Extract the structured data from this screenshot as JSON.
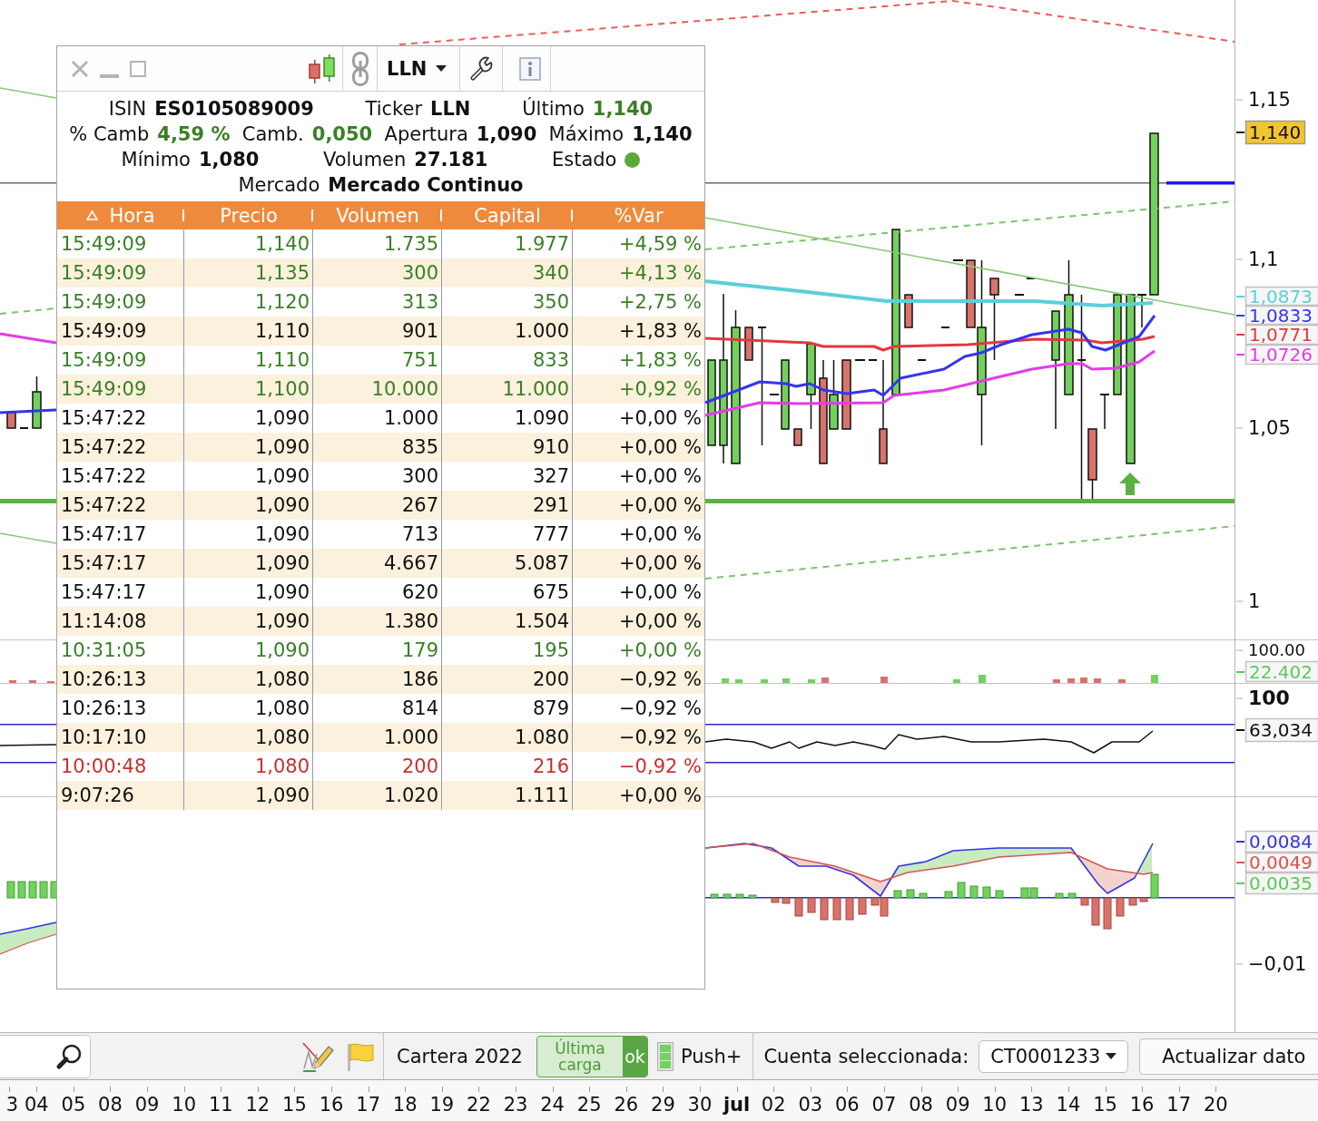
{
  "quote_window": {
    "symbol": "LLN",
    "quote_lines": [
      [
        {
          "kind": "value",
          "label": "ISIN",
          "value": "ES0105089009",
          "color": "#111111",
          "bold": true
        },
        {
          "kind": "value",
          "label": "Ticker",
          "value": "LLN",
          "color": "#111111",
          "bold": true
        },
        {
          "kind": "value",
          "label": "Último",
          "value": "1,140",
          "color": "#3b7f26",
          "bold": true
        }
      ],
      [
        {
          "kind": "value",
          "label": "% Camb",
          "value": "4,59 %",
          "color": "#3b7f26",
          "bold": true
        },
        {
          "kind": "value",
          "label": "Camb.",
          "value": "0,050",
          "color": "#3b7f26",
          "bold": true
        },
        {
          "kind": "value",
          "label": "Apertura",
          "value": "1,090",
          "color": "#111111",
          "bold": true
        },
        {
          "kind": "value",
          "label": "Máximo",
          "value": "1,140",
          "color": "#111111",
          "bold": true
        }
      ],
      [
        {
          "kind": "value",
          "label": "Mínimo",
          "value": "1,080",
          "color": "#111111",
          "bold": true
        },
        {
          "kind": "value",
          "label": "Volumen",
          "value": "27.181",
          "color": "#111111",
          "bold": true
        },
        {
          "kind": "status",
          "label": "Estado",
          "color": "#5aaa38"
        }
      ],
      [
        {
          "kind": "value",
          "label": "Mercado",
          "value": "Mercado Continuo",
          "color": "#111111",
          "bold": true
        }
      ]
    ],
    "table": {
      "columns": [
        {
          "label": "Hora",
          "sorted": true
        },
        {
          "label": "Precio",
          "sorted": false
        },
        {
          "label": "Volumen",
          "sorted": false
        },
        {
          "label": "Capital",
          "sorted": false
        },
        {
          "label": "%Var",
          "sorted": false
        }
      ],
      "rows": [
        {
          "color": "#3b7f26",
          "cells": [
            "15:49:09",
            "1,140",
            "1.735",
            "1.977",
            "+4,59 %"
          ]
        },
        {
          "color": "#3b7f26",
          "cells": [
            "15:49:09",
            "1,135",
            "300",
            "340",
            "+4,13 %"
          ]
        },
        {
          "color": "#3b7f26",
          "cells": [
            "15:49:09",
            "1,120",
            "313",
            "350",
            "+2,75 %"
          ]
        },
        {
          "color": "#111111",
          "cells": [
            "15:49:09",
            "1,110",
            "901",
            "1.000",
            "+1,83 %"
          ]
        },
        {
          "color": "#3b7f26",
          "cells": [
            "15:49:09",
            "1,110",
            "751",
            "833",
            "+1,83 %"
          ]
        },
        {
          "color": "#3b7f26",
          "cells": [
            "15:49:09",
            "1,100",
            "10.000",
            "11.000",
            "+0,92 %"
          ]
        },
        {
          "color": "#111111",
          "cells": [
            "15:47:22",
            "1,090",
            "1.000",
            "1.090",
            "+0,00 %"
          ]
        },
        {
          "color": "#111111",
          "cells": [
            "15:47:22",
            "1,090",
            "835",
            "910",
            "+0,00 %"
          ]
        },
        {
          "color": "#111111",
          "cells": [
            "15:47:22",
            "1,090",
            "300",
            "327",
            "+0,00 %"
          ]
        },
        {
          "color": "#111111",
          "cells": [
            "15:47:22",
            "1,090",
            "267",
            "291",
            "+0,00 %"
          ]
        },
        {
          "color": "#111111",
          "cells": [
            "15:47:17",
            "1,090",
            "713",
            "777",
            "+0,00 %"
          ]
        },
        {
          "color": "#111111",
          "cells": [
            "15:47:17",
            "1,090",
            "4.667",
            "5.087",
            "+0,00 %"
          ]
        },
        {
          "color": "#111111",
          "cells": [
            "15:47:17",
            "1,090",
            "620",
            "675",
            "+0,00 %"
          ]
        },
        {
          "color": "#111111",
          "cells": [
            "11:14:08",
            "1,090",
            "1.380",
            "1.504",
            "+0,00 %"
          ]
        },
        {
          "color": "#3b7f26",
          "cells": [
            "10:31:05",
            "1,090",
            "179",
            "195",
            "+0,00 %"
          ]
        },
        {
          "color": "#111111",
          "cells": [
            "10:26:13",
            "1,080",
            "186",
            "200",
            "−0,92 %"
          ]
        },
        {
          "color": "#111111",
          "cells": [
            "10:26:13",
            "1,080",
            "814",
            "879",
            "−0,92 %"
          ]
        },
        {
          "color": "#111111",
          "cells": [
            "10:17:10",
            "1,080",
            "1.000",
            "1.080",
            "−0,92 %"
          ]
        },
        {
          "color": "#c9302c",
          "cells": [
            "10:00:48",
            "1,080",
            "200",
            "216",
            "−0,92 %"
          ]
        },
        {
          "color": "#111111",
          "cells": [
            "9:07:26",
            "1,090",
            "1.020",
            "1.111",
            "+0,00 %"
          ]
        }
      ]
    }
  },
  "chart": {
    "price_pane": {
      "axis_labels": [
        "1,15",
        "1,1",
        "1,05",
        "1"
      ],
      "value_tags": [
        {
          "kind": "highlight",
          "text": "1,140",
          "color": "#f2c530"
        },
        {
          "kind": "line",
          "text": "1,0873",
          "color": "#5ccfd8"
        },
        {
          "kind": "line",
          "text": "1,0833",
          "color": "#3535ee"
        },
        {
          "kind": "line",
          "text": "1,0771",
          "color": "#e2383f"
        },
        {
          "kind": "line",
          "text": "1,0726",
          "color": "#e33ce6"
        }
      ]
    },
    "volume_pane": {
      "axis_labels": [
        "100.00"
      ],
      "value_tags": [
        {
          "kind": "line",
          "text": "22.402",
          "color": "#5cc95c"
        }
      ]
    },
    "rsi_pane": {
      "axis_labels": [
        "100"
      ],
      "value_tags": [
        {
          "kind": "line",
          "text": "63,034",
          "color": "#111111"
        }
      ]
    },
    "macd_pane": {
      "axis_labels": [
        "−0,01"
      ],
      "value_tags": [
        {
          "kind": "line",
          "text": "0,0084",
          "color": "#3535e0"
        },
        {
          "kind": "line",
          "text": "0,0049",
          "color": "#d9534f"
        },
        {
          "kind": "line",
          "text": "0,0035",
          "color": "#5cc95c"
        }
      ]
    }
  },
  "toolbar": {
    "portfolio": "Cartera 2022",
    "load_button": {
      "label": "Última carga",
      "badge": "ok"
    },
    "push_label": "Push+",
    "account_label": "Cuenta seleccionada:",
    "account": "CT0001233",
    "update_button": "Actualizar dato"
  },
  "date_axis": [
    {
      "kind": "day",
      "label": "3"
    },
    {
      "kind": "day",
      "label": "04"
    },
    {
      "kind": "day",
      "label": "05"
    },
    {
      "kind": "day",
      "label": "08"
    },
    {
      "kind": "day",
      "label": "09"
    },
    {
      "kind": "day",
      "label": "10"
    },
    {
      "kind": "day",
      "label": "11"
    },
    {
      "kind": "day",
      "label": "12"
    },
    {
      "kind": "day",
      "label": "15"
    },
    {
      "kind": "day",
      "label": "16"
    },
    {
      "kind": "day",
      "label": "17"
    },
    {
      "kind": "day",
      "label": "18"
    },
    {
      "kind": "day",
      "label": "19"
    },
    {
      "kind": "day",
      "label": "22"
    },
    {
      "kind": "day",
      "label": "23"
    },
    {
      "kind": "day",
      "label": "24"
    },
    {
      "kind": "day",
      "label": "25"
    },
    {
      "kind": "day",
      "label": "26"
    },
    {
      "kind": "day",
      "label": "29"
    },
    {
      "kind": "day",
      "label": "30"
    },
    {
      "kind": "month",
      "label": "jul"
    },
    {
      "kind": "day",
      "label": "02"
    },
    {
      "kind": "day",
      "label": "03"
    },
    {
      "kind": "day",
      "label": "06"
    },
    {
      "kind": "day",
      "label": "07"
    },
    {
      "kind": "day",
      "label": "08"
    },
    {
      "kind": "day",
      "label": "09"
    },
    {
      "kind": "day",
      "label": "10"
    },
    {
      "kind": "day",
      "label": "13"
    },
    {
      "kind": "day",
      "label": "14"
    },
    {
      "kind": "day",
      "label": "15"
    },
    {
      "kind": "day",
      "label": "16"
    },
    {
      "kind": "day",
      "label": "17"
    },
    {
      "kind": "day",
      "label": "20"
    }
  ]
}
